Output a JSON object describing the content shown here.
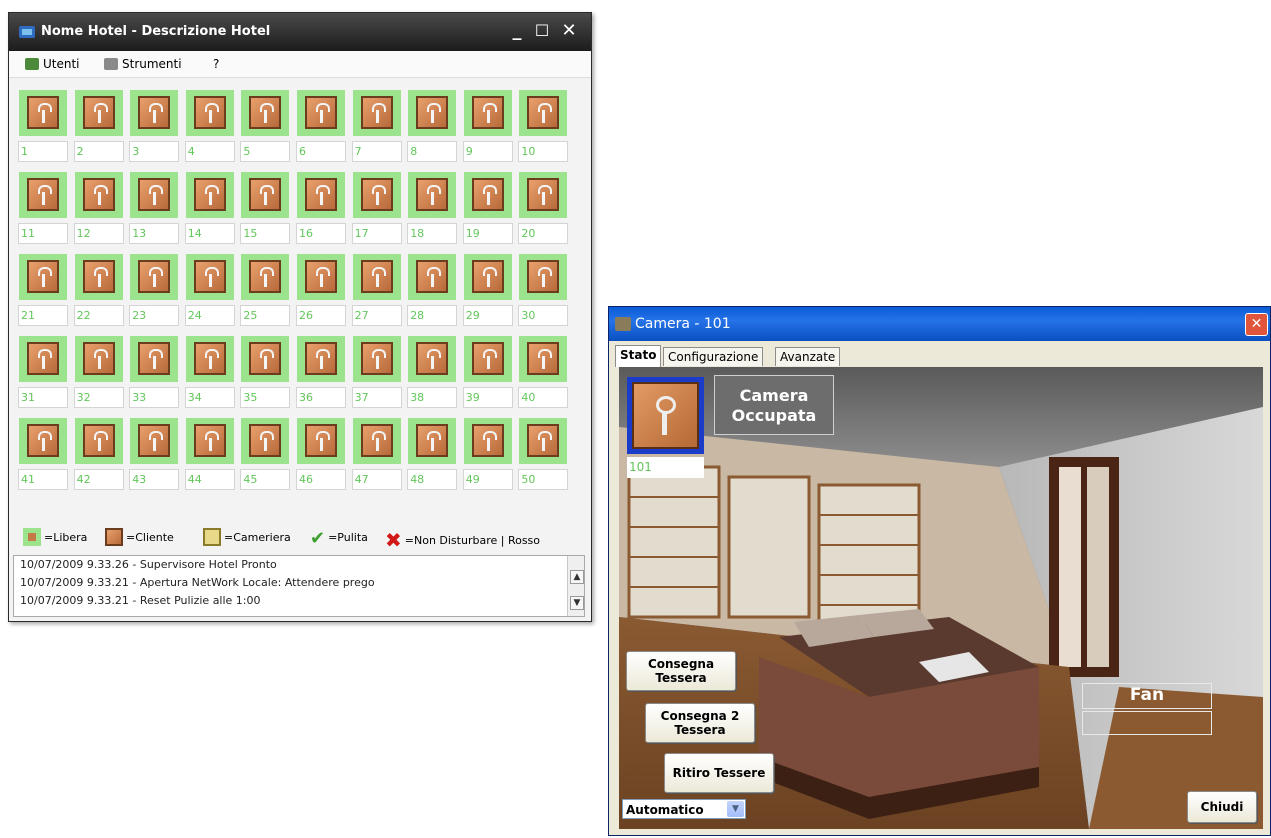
{
  "hotel_window": {
    "title": "Nome Hotel - Descrizione Hotel",
    "controls": {
      "minimize": "_",
      "maximize": "☐",
      "close": "✕"
    },
    "menu": {
      "users": "Utenti",
      "tools": "Strumenti",
      "help": "?"
    },
    "rooms": [
      "1",
      "2",
      "3",
      "4",
      "5",
      "6",
      "7",
      "8",
      "9",
      "10",
      "11",
      "12",
      "13",
      "14",
      "15",
      "16",
      "17",
      "18",
      "19",
      "20",
      "21",
      "22",
      "23",
      "24",
      "25",
      "26",
      "27",
      "28",
      "29",
      "30",
      "31",
      "32",
      "33",
      "34",
      "35",
      "36",
      "37",
      "38",
      "39",
      "40",
      "41",
      "42",
      "43",
      "44",
      "45",
      "46",
      "47",
      "48",
      "49",
      "50"
    ],
    "legend": {
      "free": "=Libera",
      "client": "=Cliente",
      "maid": "=Cameriera",
      "clean": "=Pulita",
      "dnd": "=Non Disturbare | Rosso"
    },
    "log": [
      "10/07/2009 9.33.26 - Supervisore Hotel Pronto",
      "10/07/2009 9.33.21 - Apertura NetWork Locale: Attendere prego",
      "10/07/2009 9.33.21 - Reset Pulizie alle 1:00"
    ]
  },
  "camera_window": {
    "title": "Camera - 101",
    "tabs": [
      "Stato",
      "Configurazione",
      "Avanzate"
    ],
    "room_number": "101",
    "status_line1": "Camera",
    "status_line2": "Occupata",
    "buttons": {
      "issue_card_1": "Consegna",
      "issue_card_2": "Tessera",
      "issue_two_1": "Consegna 2",
      "issue_two_2": "Tessera",
      "withdraw": "Ritiro Tessere",
      "close": "Chiudi"
    },
    "fan_label": "Fan",
    "mode_value": "Automatico"
  }
}
